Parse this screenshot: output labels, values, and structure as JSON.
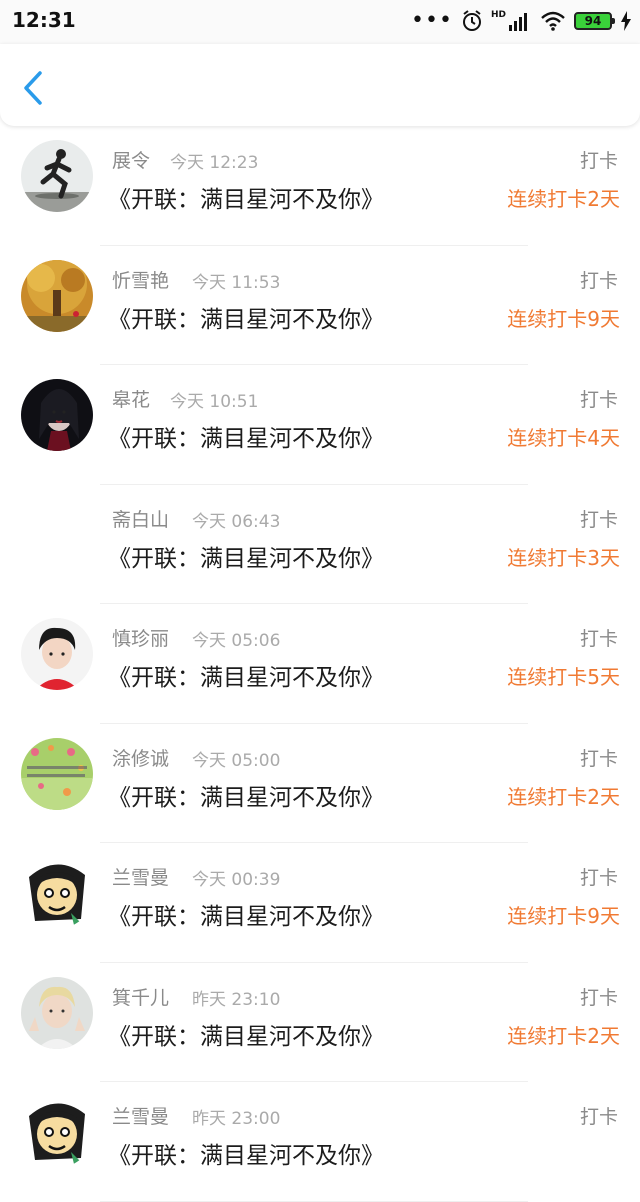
{
  "status_bar": {
    "time": "12:31",
    "battery": "94",
    "network": "HD"
  },
  "header": {
    "back_icon": "chevron-left-icon",
    "accent": "#2a9bea"
  },
  "entry_title": "《开联：满目星河不及你》",
  "checkin_label": "打卡",
  "colors": {
    "streak": "#f07a33",
    "name": "#8a8a8a",
    "title": "#1c1c1c"
  },
  "entries": [
    {
      "name": "展令",
      "time": "今天 12:23",
      "streak": "连续打卡2天",
      "avatar": "runner-photo"
    },
    {
      "name": "忻雪艳",
      "time": "今天 11:53",
      "streak": "连续打卡9天",
      "avatar": "autumn-tree-photo"
    },
    {
      "name": "皋花",
      "time": "今天 10:51",
      "streak": "连续打卡4天",
      "avatar": "dark-girl-photo"
    },
    {
      "name": "斋白山",
      "time": "今天 06:43",
      "streak": "连续打卡3天",
      "avatar": "none"
    },
    {
      "name": "慎珍丽",
      "time": "今天 05:06",
      "streak": "连续打卡5天",
      "avatar": "boy-red-shirt-photo"
    },
    {
      "name": "涂修诚",
      "time": "今天 05:00",
      "streak": "连续打卡2天",
      "avatar": "green-hearts-photo"
    },
    {
      "name": "兰雪曼",
      "time": "今天 00:39",
      "streak": "连续打卡9天",
      "avatar": "cartoon-face"
    },
    {
      "name": "箕千儿",
      "time": "昨天 23:10",
      "streak": "连续打卡2天",
      "avatar": "blonde-boy-photo"
    },
    {
      "name": "兰雪曼",
      "time": "昨天 23:00",
      "streak": "",
      "avatar": "cartoon-face"
    }
  ]
}
